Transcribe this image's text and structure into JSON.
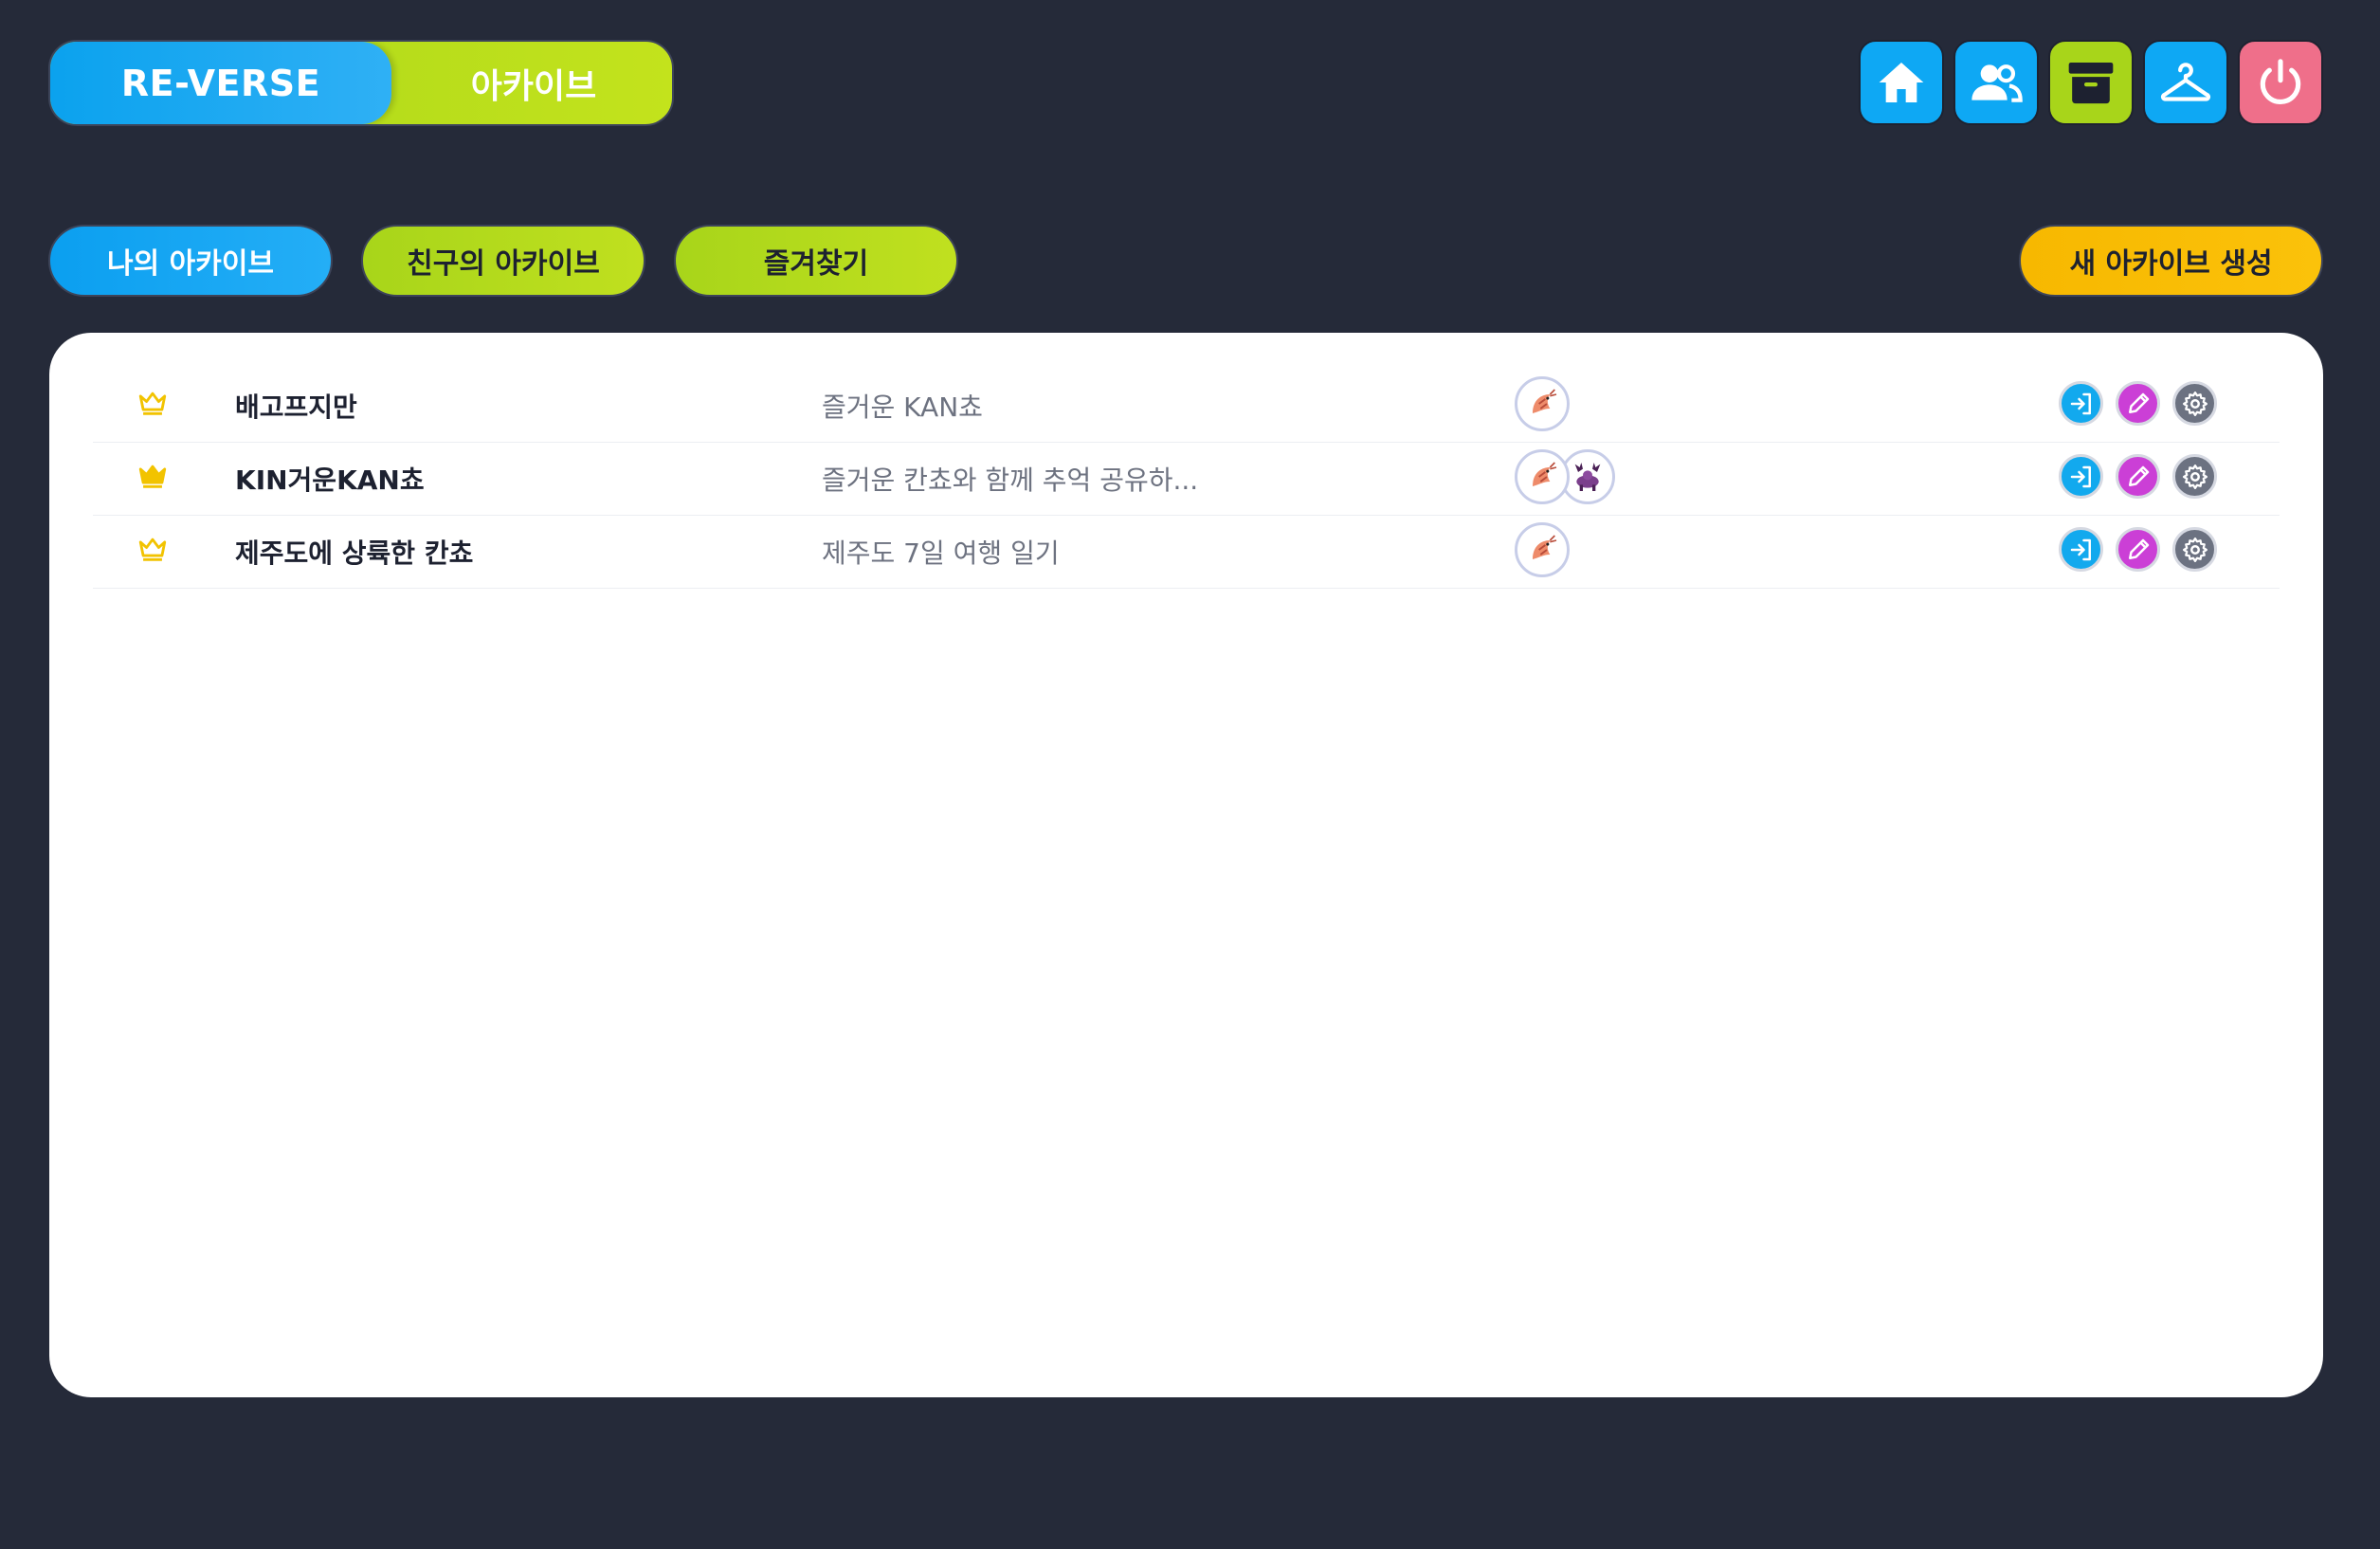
{
  "header": {
    "brand": "RE-VERSE",
    "page_title": "아카이브",
    "nav": [
      {
        "name": "home-icon"
      },
      {
        "name": "friends-icon"
      },
      {
        "name": "archive-icon"
      },
      {
        "name": "hanger-icon"
      },
      {
        "name": "power-icon"
      }
    ]
  },
  "tabs": {
    "mine": "나의 아카이브",
    "friends": "친구의 아카이브",
    "favorites": "즐겨찾기"
  },
  "create_button": "새 아카이브 생성",
  "colors": {
    "background": "#252a39",
    "blue": "#0ea8f4",
    "green": "#a8d51a",
    "yellow": "#f7b800",
    "pink": "#ef6f8a",
    "purple": "#cb3fd6",
    "gray": "#6c7281"
  },
  "archives": [
    {
      "name": "배고프지만",
      "description": "즐거운 KAN쵸",
      "owner": false,
      "members": [
        "shrimp-avatar"
      ]
    },
    {
      "name": "KIN거운KAN쵸",
      "description": "즐거운 칸쵸와 함께 추억 공유하...",
      "owner": true,
      "members": [
        "shrimp-avatar",
        "moose-avatar"
      ]
    },
    {
      "name": "제주도에 상륙한 칸쵸",
      "description": "제주도 7일 여행 일기",
      "owner": false,
      "members": [
        "shrimp-avatar"
      ]
    }
  ]
}
